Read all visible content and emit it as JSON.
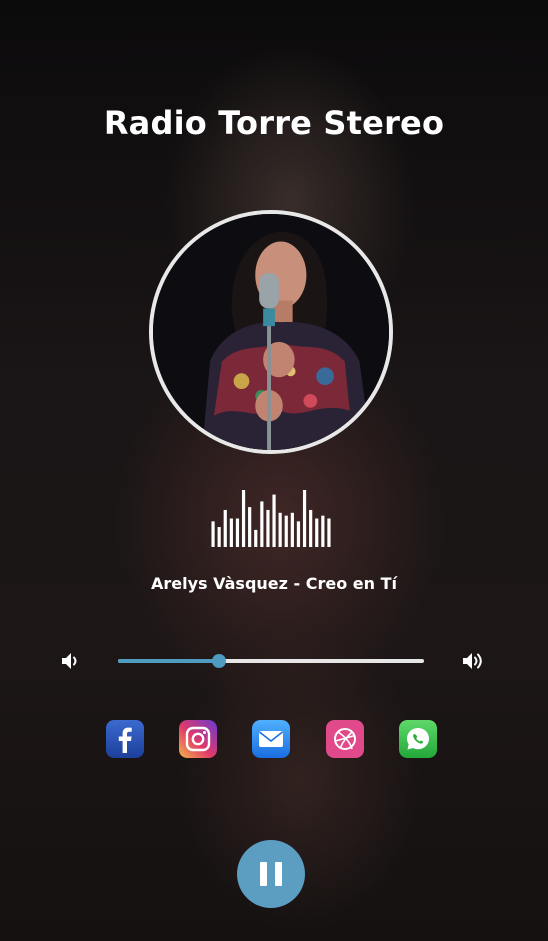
{
  "station": {
    "title": "Radio Torre Stereo"
  },
  "now_playing": {
    "track": "Arelys Vàsquez - Creo en Tí"
  },
  "volume": {
    "level": 0.33,
    "accent_color": "#4f9cc0",
    "low_icon": "volume-low-icon",
    "high_icon": "volume-high-icon"
  },
  "equalizer": {
    "levels": [
      0.45,
      0.35,
      0.65,
      0.5,
      0.5,
      1.0,
      0.7,
      0.3,
      0.8,
      0.65,
      0.92,
      0.6,
      0.55,
      0.6,
      0.45,
      1.0,
      0.65,
      0.5,
      0.55,
      0.5
    ]
  },
  "socials": [
    {
      "name": "facebook",
      "icon": "facebook-icon"
    },
    {
      "name": "instagram",
      "icon": "instagram-icon"
    },
    {
      "name": "email",
      "icon": "email-icon"
    },
    {
      "name": "dribbble",
      "icon": "dribbble-icon"
    },
    {
      "name": "whatsapp",
      "icon": "whatsapp-icon"
    }
  ],
  "player": {
    "state": "playing",
    "button_icon": "pause-icon",
    "button_color": "#5b9ec2"
  }
}
